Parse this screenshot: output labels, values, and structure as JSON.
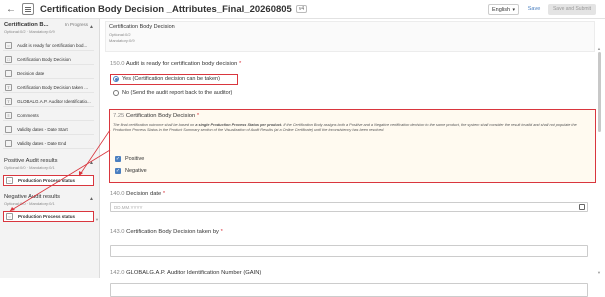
{
  "header": {
    "title": "Certification Body Decision _Attributes_Final_20260805",
    "version": "v4",
    "language": "English",
    "save_label": "Save",
    "save_submit_label": "Save and Submit"
  },
  "sidebar": {
    "section1": {
      "title": "Certification B...",
      "status": "In Progress",
      "sub": "Optional:0/2 · Mandatory:0/9"
    },
    "items": [
      {
        "label": "Audit is ready for certification bod..."
      },
      {
        "label": "Certification Body Decision"
      },
      {
        "label": "Decision date"
      },
      {
        "label": "Certification Body Decision taken ..."
      },
      {
        "label": "GLOBALG.A.P. Auditor Identificatio..."
      },
      {
        "label": "Comments"
      },
      {
        "label": "Validity dates - Date Start"
      },
      {
        "label": "Validity dates - Date End"
      }
    ],
    "section2": {
      "title": "Positive Audit results",
      "sub": "Optional:0/0 · Mandatory:0/1",
      "item": "Production Process status"
    },
    "section3": {
      "title": "Negative Audit results",
      "sub": "Optional:0/0 · Mandatory:0/1",
      "item": "Production Process status"
    }
  },
  "main": {
    "card": {
      "title": "Certification Body Decision",
      "optional": "Optional:0/2",
      "mandatory": "Mandatory:0/9"
    },
    "q1": {
      "num": "150.0",
      "label": "Audit is ready for certification body decision",
      "opt_yes": "Yes (Certification decision can be taken)",
      "opt_no": "No (Send the audit report back to the auditor)"
    },
    "q2": {
      "num": "7.25",
      "label": "Certification Body Decision",
      "info_pre": "The final certification outcome shall be based on ",
      "info_bold": "a single Production Process Status per product.",
      "info_post": " If the Certification Body assigns both a Positive and a Negative certification decision to the same product, the system shall consider the result invalid and shall not populate the Production Process Status in the Product Summary section of the Visualization of Audit Results (at a Online Certificate) until the inconsistency has been resolved.",
      "opt1": "Positive",
      "opt2": "Negative"
    },
    "q3": {
      "num": "140.0",
      "label": "Decision date",
      "placeholder": "DD.MM.YYYY"
    },
    "q4": {
      "num": "143.0",
      "label": "Certification Body Decision taken by"
    },
    "q5": {
      "num": "142.0",
      "label": "GLOBALG.A.P. Auditor Identification Number (GAIN)"
    }
  },
  "colors": {
    "accent": "#4a7fc0",
    "highlight": "#d9363e"
  }
}
